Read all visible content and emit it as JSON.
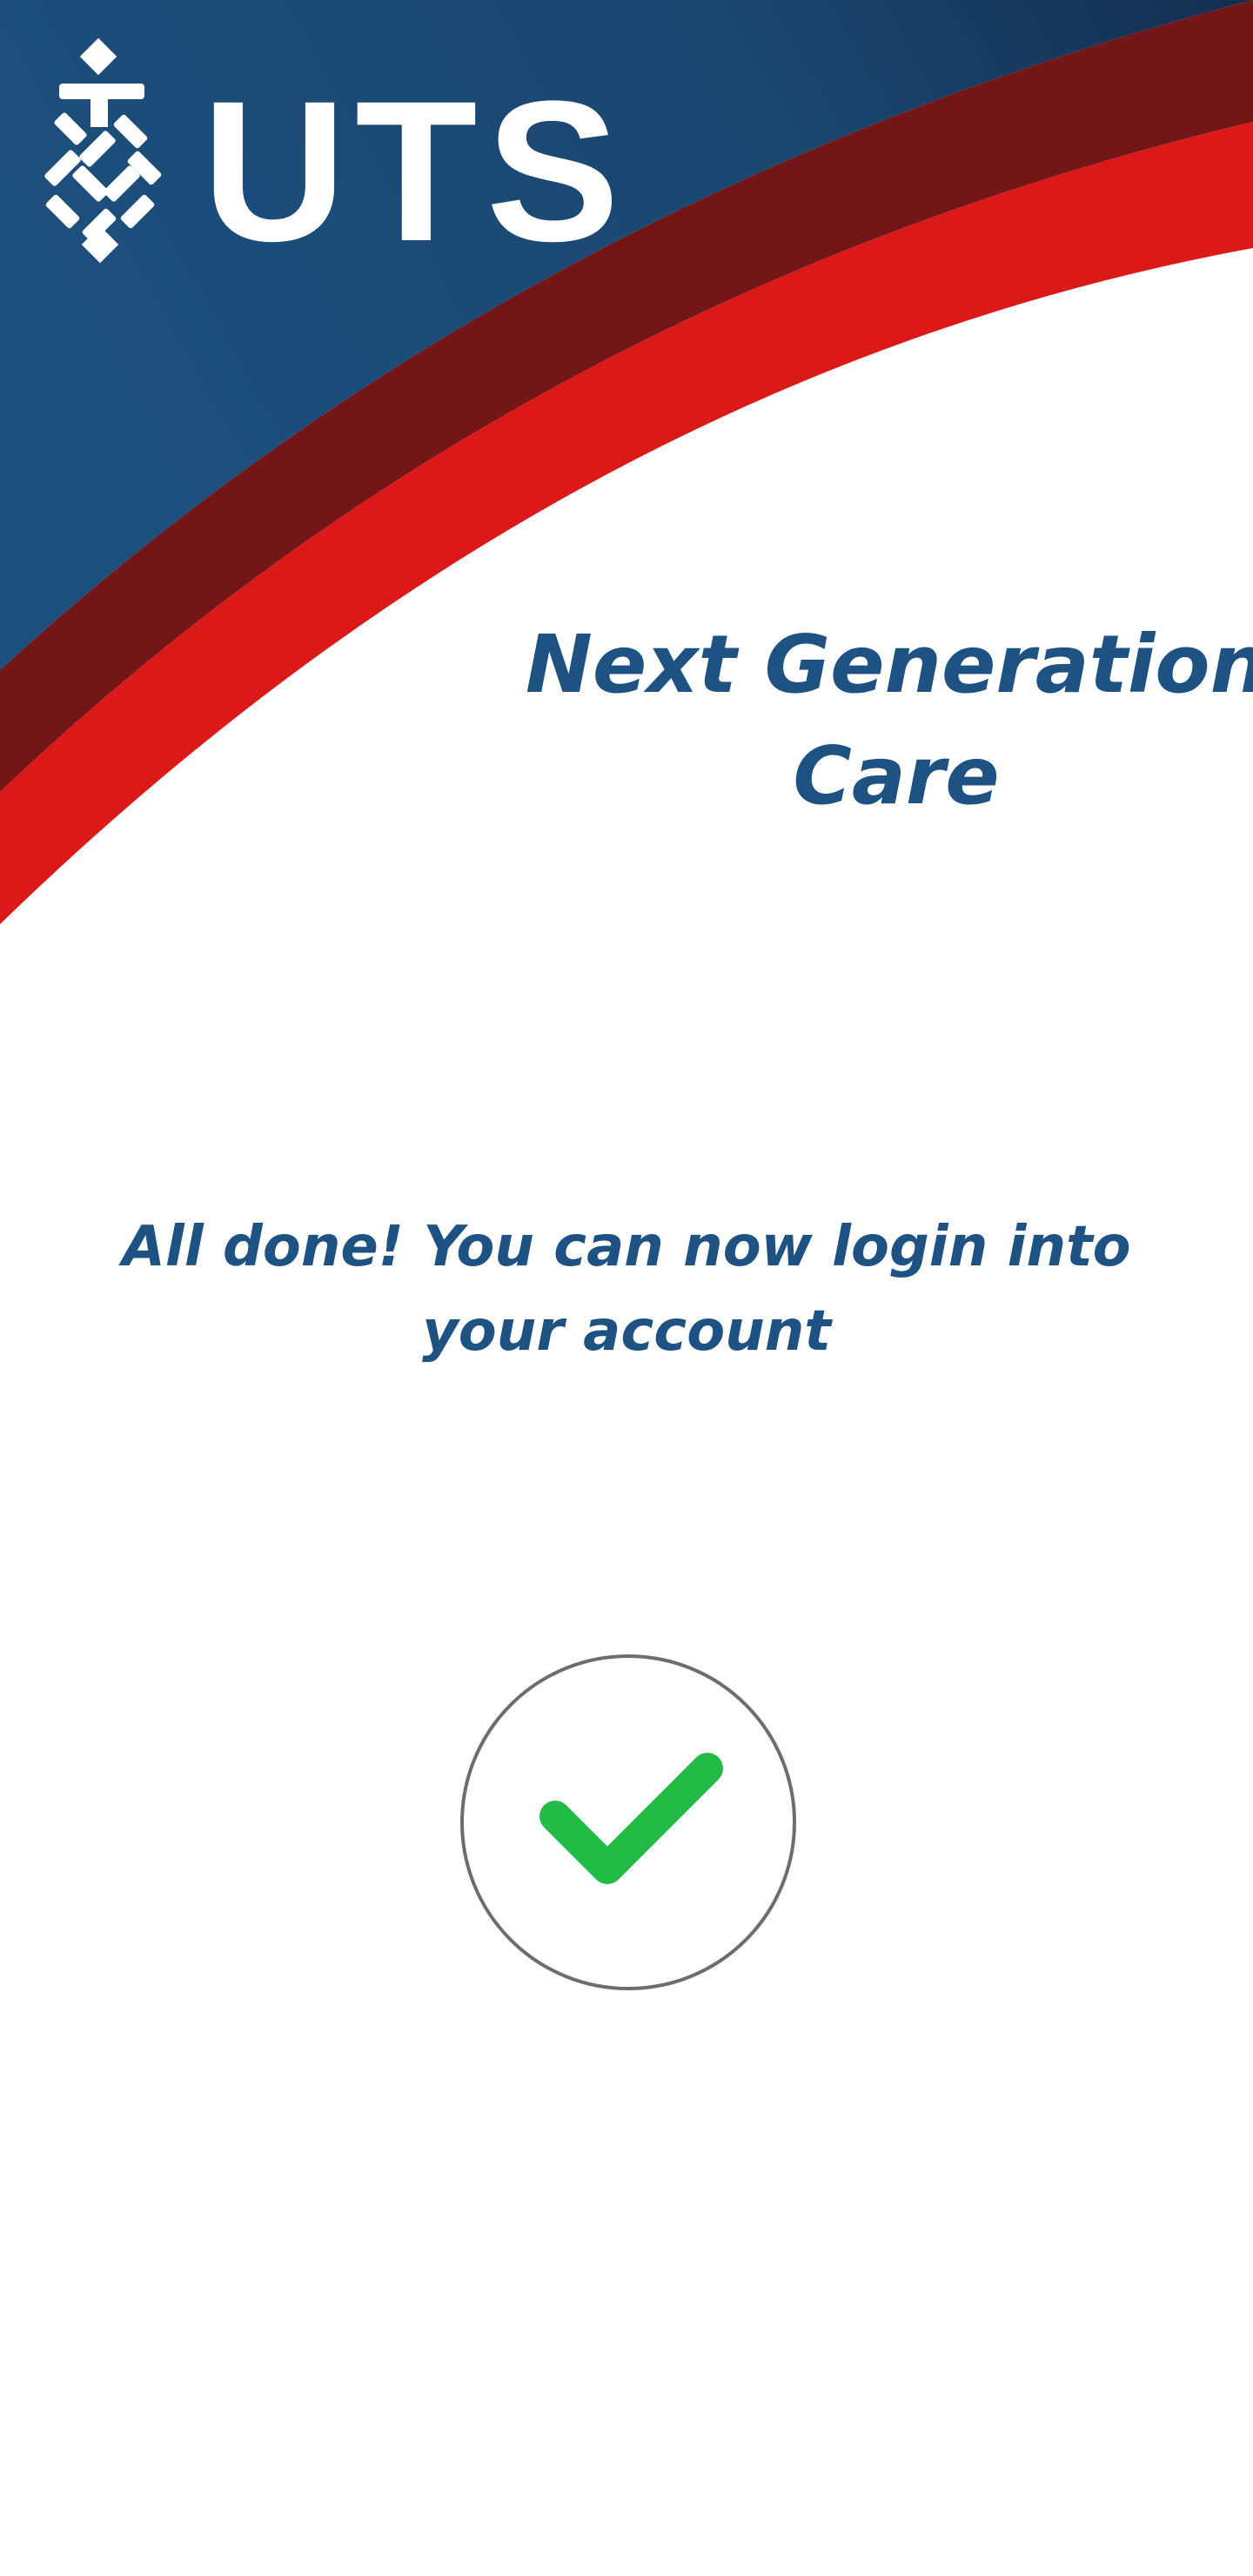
{
  "brand": {
    "logo_text": "UTS",
    "colors": {
      "navy": "#1d4f7d",
      "navy_dark": "#142f4f",
      "maroon": "#731618",
      "red": "#dc1919",
      "title_blue": "#1d5282",
      "success_green": "#22bb45"
    }
  },
  "header": {
    "title_line1": "Next Generation",
    "title_line2": "Care"
  },
  "message": {
    "line1": "All done! You can now login into",
    "line2": "your account"
  },
  "status": {
    "icon": "check-circle-icon"
  }
}
